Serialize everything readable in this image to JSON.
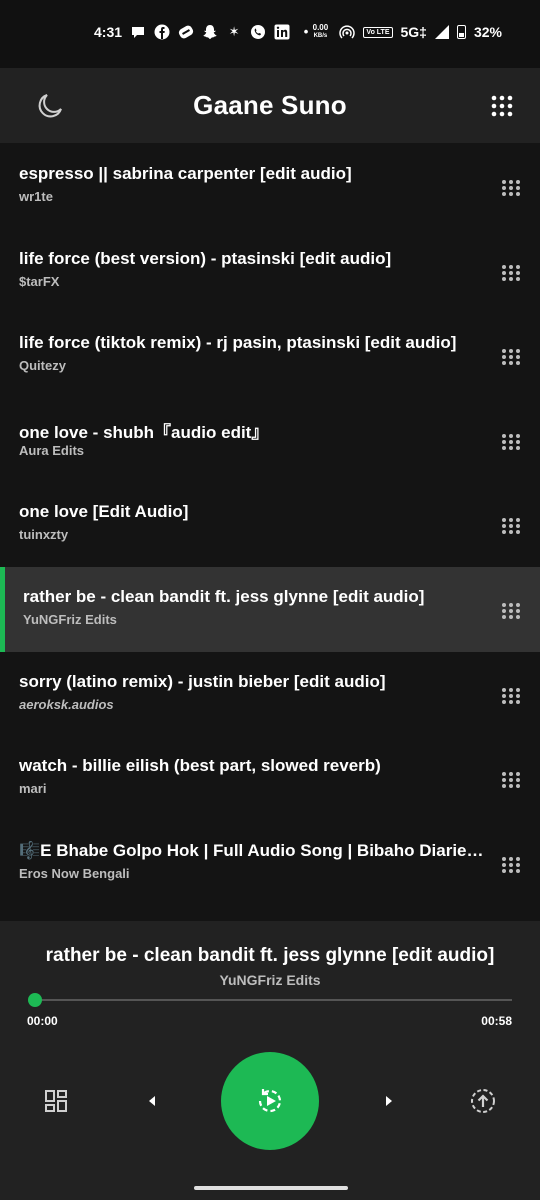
{
  "status_bar": {
    "time": "4:31",
    "net_speed_value": "0.00",
    "net_speed_unit": "KB/s",
    "volte": "Vo LTE",
    "network": "5G‡",
    "battery": "32%",
    "notification_icons": [
      "chat-bubble-icon",
      "facebook-icon",
      "gaming-icon",
      "snapchat-icon",
      "sparkle-icon",
      "whatsapp-icon",
      "linkedin-icon",
      "dot-icon"
    ]
  },
  "header": {
    "title": "Gaane Suno",
    "left_icon": "moon-icon",
    "right_icon": "grid-menu-icon"
  },
  "songs": [
    {
      "title": "espresso || sabrina carpenter [edit audio]",
      "artist": "wr1te"
    },
    {
      "title": "life force (best version) - ptasinski [edit audio]",
      "artist": "$tarFX"
    },
    {
      "title": "life force (tiktok remix) - rj pasin, ptasinski [edit audio]",
      "artist": "Quitezy"
    },
    {
      "title": "one love - shubh『audio edit』",
      "artist": "Aura Edits"
    },
    {
      "title": "one love [Edit Audio]",
      "artist": "tuinxzty"
    },
    {
      "title": "rather be - clean bandit ft. jess glynne [edit audio]",
      "artist": "YuNGFriz Edits",
      "active": true
    },
    {
      "title": "sorry (latino remix) - justin bieber [edit audio]",
      "artist": "aeroksk.audios"
    },
    {
      "title": "watch - billie eilish (best part, slowed reverb)",
      "artist": "mari"
    },
    {
      "title": "🎼E Bhabe Golpo Hok | Full Audio Song | Bibaho Diaries | Eros Now Bengali",
      "artist": "Eros Now Bengali"
    }
  ],
  "player": {
    "title": "rather be - clean bandit ft. jess glynne [edit audio]",
    "artist": "YuNGFriz Edits",
    "current_time": "00:00",
    "total_time": "00:58",
    "progress": 0
  },
  "colors": {
    "accent": "#1db954",
    "background": "#141414",
    "surface": "#222222",
    "active_row": "#333333"
  }
}
